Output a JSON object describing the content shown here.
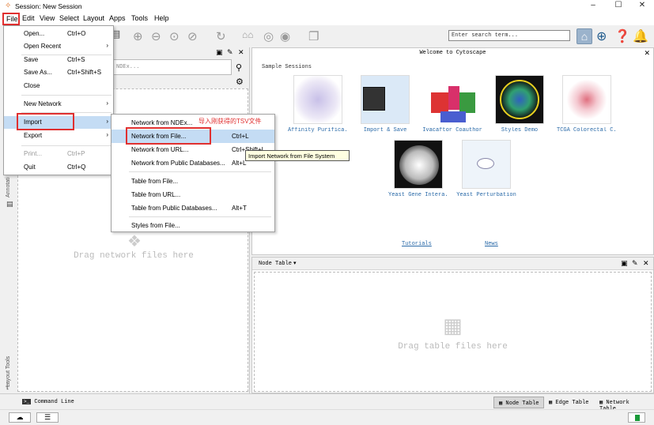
{
  "window": {
    "title": "Session: New Session",
    "min": "–",
    "max": "☐",
    "close": "✕"
  },
  "menubar": [
    "File",
    "Edit",
    "View",
    "Select",
    "Layout",
    "Apps",
    "Tools",
    "Help"
  ],
  "file_menu": [
    {
      "label": "Open...",
      "shortcut": "Ctrl+O"
    },
    {
      "label": "Open Recent",
      "arrow": "›"
    },
    {
      "label": "Save",
      "shortcut": "Ctrl+S"
    },
    {
      "label": "Save As...",
      "shortcut": "Ctrl+Shift+S"
    },
    {
      "label": "Close"
    },
    {
      "label": "New Network",
      "arrow": "›"
    },
    {
      "label": "Import",
      "arrow": "›"
    },
    {
      "label": "Export",
      "arrow": "›"
    },
    {
      "label": "Print...",
      "shortcut": "Ctrl+P"
    },
    {
      "label": "Quit",
      "shortcut": "Ctrl+Q"
    }
  ],
  "import_menu": [
    {
      "label": "Network from NDEx...",
      "shortcut": ""
    },
    {
      "label": "Network from File...",
      "shortcut": "Ctrl+L"
    },
    {
      "label": "Network from URL...",
      "shortcut": "Ctrl+Shift+L"
    },
    {
      "label": "Network from Public Databases...",
      "shortcut": "Alt+L"
    },
    {
      "label": "Table from File...",
      "shortcut": ""
    },
    {
      "label": "Table from URL...",
      "shortcut": ""
    },
    {
      "label": "Table from Public Databases...",
      "shortcut": "Alt+T"
    },
    {
      "label": "Styles from File...",
      "shortcut": ""
    }
  ],
  "annotation": "导入刚获得的TSV文件",
  "tooltip": "Import Network from File System",
  "toolbar": {
    "search_placeholder": "Enter search term..."
  },
  "left_panel": {
    "ndex_placeholder": "NDEx...",
    "drop_text": "Drag network files here",
    "side_tabs": [
      "Annotati",
      "Layout Tools"
    ]
  },
  "welcome": {
    "title": "Welcome to Cytoscape",
    "sample_label": "Sample Sessions",
    "sessions": [
      "Affinity Purifica...",
      "Import & Save",
      "Ivacaftor Coauthor",
      "Styles Demo",
      "TCGA Colorectal C...",
      "Yeast Gene Intera...",
      "Yeast Perturbation"
    ],
    "links": [
      "Tutorials",
      "News"
    ]
  },
  "table_panel": {
    "title": "Node Table",
    "dropdown": "▾",
    "drop_text": "Drag table files here"
  },
  "bottom_tabs": {
    "command_line": "Command Line",
    "tabs": [
      "Node Table",
      "Edge Table",
      "Network Table"
    ]
  },
  "colors": {
    "accent_red": "#e03030",
    "link_blue": "#2a6aa8",
    "highlight": "#c4dcf4"
  }
}
